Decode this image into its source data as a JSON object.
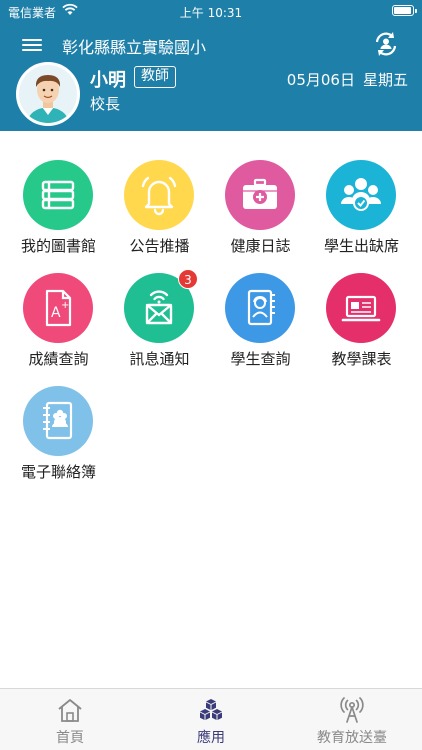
{
  "status_bar": {
    "carrier": "電信業者",
    "time": "上午 10:31"
  },
  "header": {
    "school_name": "彰化縣縣立實驗國小",
    "user_name": "小明",
    "role": "教師",
    "title": "校長",
    "date": "05月06日",
    "weekday": "星期五"
  },
  "apps": [
    {
      "label": "我的圖書館",
      "icon": "books-icon",
      "color": "#26c98a"
    },
    {
      "label": "公告推播",
      "icon": "bell-icon",
      "color": "#ffd84d"
    },
    {
      "label": "健康日誌",
      "icon": "first-aid-kit-icon",
      "color": "#e05aa0"
    },
    {
      "label": "學生出缺席",
      "icon": "attendance-group-icon",
      "color": "#1bb3d6"
    },
    {
      "label": "成績查詢",
      "icon": "grade-document-icon",
      "color": "#f04a7a"
    },
    {
      "label": "訊息通知",
      "icon": "message-envelope-icon",
      "color": "#1fbe93",
      "badge": "3"
    },
    {
      "label": "學生查詢",
      "icon": "student-directory-icon",
      "color": "#3d98e6"
    },
    {
      "label": "教學課表",
      "icon": "laptop-schedule-icon",
      "color": "#e52f6b"
    },
    {
      "label": "電子聯絡簿",
      "icon": "contact-book-icon",
      "color": "#7fc1e8"
    }
  ],
  "tabbar": {
    "home": "首頁",
    "apps": "應用",
    "broadcast": "教育放送臺"
  },
  "colors": {
    "header_bg": "#1e7fa8",
    "tab_active": "#3b3b7a"
  }
}
